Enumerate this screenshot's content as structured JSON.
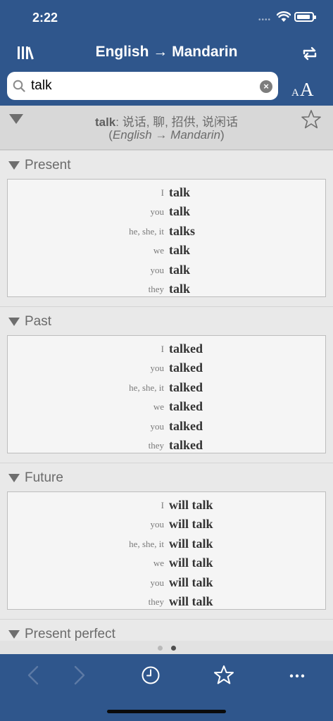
{
  "status_bar": {
    "time": "2:22"
  },
  "nav": {
    "title": "English → Mandarin"
  },
  "search": {
    "value": "talk",
    "clear_label": "×"
  },
  "font_button": {
    "small": "A",
    "big": "A"
  },
  "entry": {
    "word": "talk",
    "translations": ": 说话, 聊, 招供, 说闲话",
    "direction_open": "(",
    "direction": "English → Mandarin",
    "direction_close": ")"
  },
  "sections": [
    {
      "label": "Present",
      "rows": [
        {
          "pronoun": "I",
          "verb": "talk"
        },
        {
          "pronoun": "you",
          "verb": "talk"
        },
        {
          "pronoun": "he, she, it",
          "verb": "talks"
        },
        {
          "pronoun": "we",
          "verb": "talk"
        },
        {
          "pronoun": "you",
          "verb": "talk"
        },
        {
          "pronoun": "they",
          "verb": "talk"
        }
      ]
    },
    {
      "label": "Past",
      "rows": [
        {
          "pronoun": "I",
          "verb": "talked"
        },
        {
          "pronoun": "you",
          "verb": "talked"
        },
        {
          "pronoun": "he, she, it",
          "verb": "talked"
        },
        {
          "pronoun": "we",
          "verb": "talked"
        },
        {
          "pronoun": "you",
          "verb": "talked"
        },
        {
          "pronoun": "they",
          "verb": "talked"
        }
      ]
    },
    {
      "label": "Future",
      "rows": [
        {
          "pronoun": "I",
          "verb": "will talk"
        },
        {
          "pronoun": "you",
          "verb": "will talk"
        },
        {
          "pronoun": "he, she, it",
          "verb": "will talk"
        },
        {
          "pronoun": "we",
          "verb": "will talk"
        },
        {
          "pronoun": "you",
          "verb": "will talk"
        },
        {
          "pronoun": "they",
          "verb": "will talk"
        }
      ]
    },
    {
      "label": "Present perfect",
      "rows": []
    }
  ],
  "pager": {
    "pages": 2,
    "current": 2
  },
  "colors": {
    "header": "#2f568c",
    "toolbar_icon": "#ffffff",
    "toolbar_icon_disabled": "#5d7aa5"
  },
  "toolbar": {
    "icons": [
      "back-icon",
      "forward-icon",
      "history-icon",
      "favorites-icon",
      "more-icon"
    ]
  }
}
